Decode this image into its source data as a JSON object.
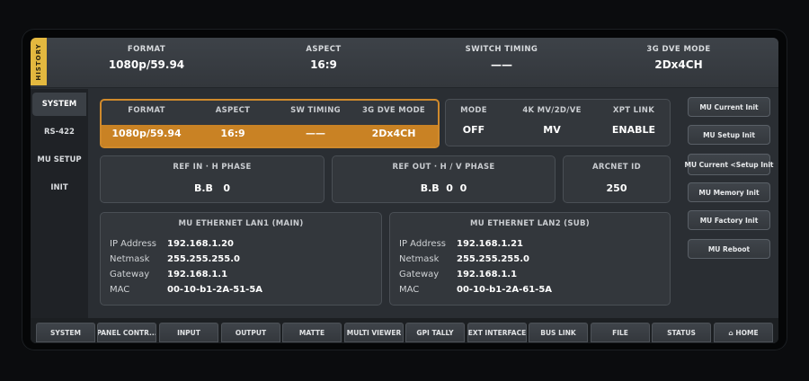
{
  "header": {
    "history_label": "HISTORY",
    "columns": [
      {
        "label": "FORMAT",
        "value": "1080p/59.94"
      },
      {
        "label": "ASPECT",
        "value": "16:9"
      },
      {
        "label": "SWITCH TIMING",
        "value": "——"
      },
      {
        "label": "3G DVE MODE",
        "value": "2Dx4CH"
      }
    ]
  },
  "sidebar": {
    "items": [
      {
        "label": "SYSTEM"
      },
      {
        "label": "RS-422"
      },
      {
        "label": "MU SETUP"
      },
      {
        "label": "INIT"
      }
    ]
  },
  "format_panel": {
    "format_label": "FORMAT",
    "format_value": "1080p/59.94",
    "aspect_label": "ASPECT",
    "aspect_value": "16:9",
    "sw_label": "SW TIMING",
    "sw_value": "——",
    "dve_label": "3G DVE MODE",
    "dve_value": "2Dx4CH"
  },
  "mode_panel": {
    "mode_label": "MODE",
    "mode_value": "OFF",
    "mv_label": "4K MV/2D/VE",
    "mv_value": "MV",
    "xpt_label": "XPT LINK",
    "xpt_value": "ENABLE"
  },
  "ref_in": {
    "title": "REF IN · H PHASE",
    "value": "B.B   0"
  },
  "ref_out": {
    "title": "REF OUT · H / V PHASE",
    "value": "B.B  0  0"
  },
  "arcnet": {
    "title": "ARCNET ID",
    "value": "250"
  },
  "lan1": {
    "title": "MU ETHERNET LAN1 (MAIN)",
    "rows": [
      {
        "key": "IP Address",
        "value": "192.168.1.20"
      },
      {
        "key": "Netmask",
        "value": "255.255.255.0"
      },
      {
        "key": "Gateway",
        "value": "192.168.1.1"
      },
      {
        "key": "MAC",
        "value": "00-10-b1-2A-51-5A"
      }
    ]
  },
  "lan2": {
    "title": "MU ETHERNET LAN2 (SUB)",
    "rows": [
      {
        "key": "IP Address",
        "value": "192.168.1.21"
      },
      {
        "key": "Netmask",
        "value": "255.255.255.0"
      },
      {
        "key": "Gateway",
        "value": "192.168.1.1"
      },
      {
        "key": "MAC",
        "value": "00-10-b1-2A-61-5A"
      }
    ]
  },
  "right_buttons": [
    {
      "label": "MU Current Init"
    },
    {
      "label": "MU Setup Init"
    },
    {
      "label": "MU Current <Setup Init"
    },
    {
      "label": "MU Memory Init"
    },
    {
      "label": "MU Factory Init"
    },
    {
      "label": "MU Reboot"
    }
  ],
  "bottom_tabs": [
    {
      "label": "SYSTEM"
    },
    {
      "label": "PANEL CONTR..."
    },
    {
      "label": "INPUT"
    },
    {
      "label": "OUTPUT"
    },
    {
      "label": "MATTE"
    },
    {
      "label": "MULTI VIEWER"
    },
    {
      "label": "GPI TALLY"
    },
    {
      "label": "EXT INTERFACE"
    },
    {
      "label": "BUS LINK"
    },
    {
      "label": "FILE"
    },
    {
      "label": "STATUS"
    },
    {
      "label": "⌂ HOME"
    }
  ],
  "colors": {
    "accent": "#d08a2c",
    "history_tab": "#e3b83f",
    "background": "#2a2e33"
  }
}
